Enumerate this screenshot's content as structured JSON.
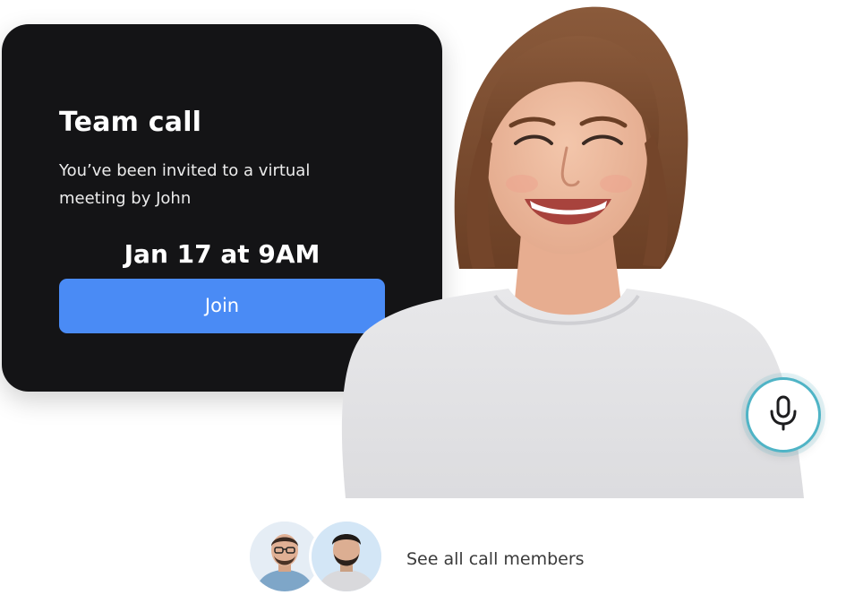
{
  "invite": {
    "title": "Team call",
    "description": "You’ve been invited to a virtual meeting by John",
    "datetime": "Jan 17 at 9AM",
    "join_label": "Join"
  },
  "participant": {
    "photo_icon": "smiling-woman-photo"
  },
  "controls": {
    "mic_icon": "microphone-icon",
    "accent_color": "#4fb4c6"
  },
  "members": {
    "avatars": [
      "man-with-glasses-avatar",
      "man-with-beard-avatar"
    ],
    "link_label": "See all call members"
  },
  "colors": {
    "card_background": "#141416",
    "join_button": "#4a8bf5"
  }
}
